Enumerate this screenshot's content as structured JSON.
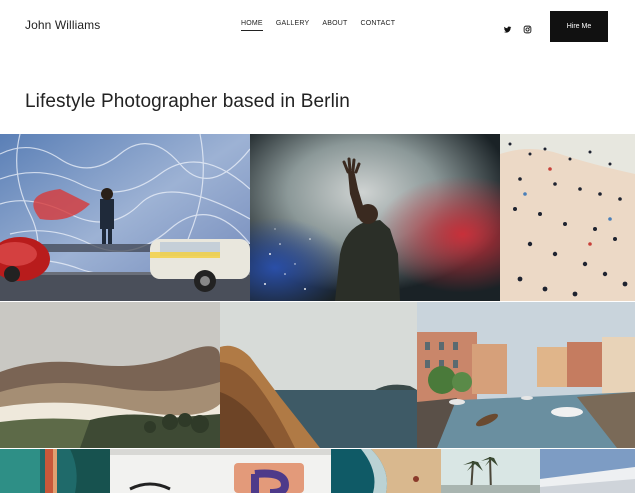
{
  "header": {
    "brand": "John Williams",
    "nav": [
      {
        "label": "HOME",
        "active": true
      },
      {
        "label": "GALLERY",
        "active": false
      },
      {
        "label": "ABOUT",
        "active": false
      },
      {
        "label": "CONTACT",
        "active": false
      }
    ],
    "social": [
      {
        "icon": "twitter-icon"
      },
      {
        "icon": "instagram-icon"
      }
    ],
    "cta_label": "Hire Me"
  },
  "main": {
    "headline": "Lifestyle Photographer based in Berlin"
  },
  "gallery": {
    "photos": [
      {
        "name": "photo-graffiti-street"
      },
      {
        "name": "photo-concert-smoke"
      },
      {
        "name": "photo-beach-crowd"
      },
      {
        "name": "photo-misty-hills"
      },
      {
        "name": "photo-cliff-sea"
      },
      {
        "name": "photo-venice-canal"
      },
      {
        "name": "photo-aerial-water"
      },
      {
        "name": "photo-white-wall-letter"
      },
      {
        "name": "photo-aerial-coast"
      },
      {
        "name": "photo-palm-trees"
      },
      {
        "name": "photo-blue-sky-building"
      }
    ]
  }
}
